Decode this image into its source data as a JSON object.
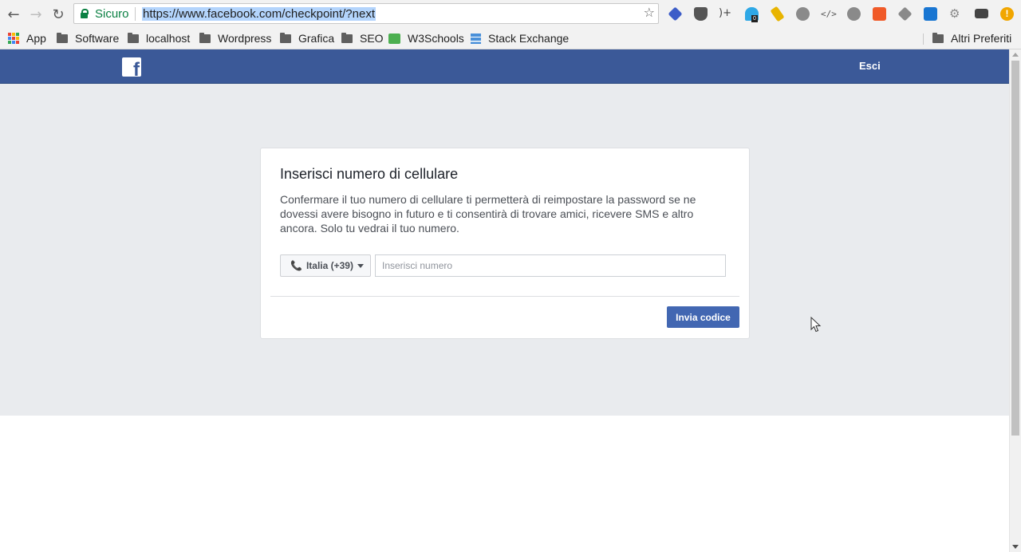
{
  "browser": {
    "back_icon": "arrow-left-icon",
    "forward_icon": "arrow-right-icon",
    "reload_icon": "reload-icon",
    "secure_label": "Sicuro",
    "url": "https://www.facebook.com/checkpoint/?next",
    "bookmark_star_icon": "star-icon",
    "extensions": [
      "box-extension-icon",
      "pocket-icon",
      "rss-plus-icon",
      "ghostery-icon",
      "broom-icon",
      "web-developer-icon",
      "code-icon",
      "wordpress-icon",
      "zoho-icon",
      "layers-icon",
      "cloud-icon",
      "gear-icon",
      "laptop-icon",
      "warning-icon"
    ],
    "extension_badge": "0"
  },
  "bookmarks": {
    "items": [
      {
        "label": "App",
        "icon": "apps-grid-icon"
      },
      {
        "label": "Software",
        "icon": "folder-icon"
      },
      {
        "label": "localhost",
        "icon": "folder-icon"
      },
      {
        "label": "Wordpress",
        "icon": "folder-icon"
      },
      {
        "label": "Grafica",
        "icon": "folder-icon"
      },
      {
        "label": "SEO",
        "icon": "folder-icon"
      },
      {
        "label": "W3Schools",
        "icon": "w3schools-icon"
      },
      {
        "label": "Stack Exchange",
        "icon": "stack-exchange-icon"
      }
    ],
    "other": "Altri Preferiti"
  },
  "header": {
    "logo_letter": "f",
    "logout_label": "Esci",
    "color": "#3b5998"
  },
  "dialog": {
    "title": "Inserisci numero di cellulare",
    "description": "Confermare il tuo numero di cellulare ti permetterà di reimpostare la password se ne dovessi avere bisogno in futuro e ti consentirà di trovare amici, ricevere SMS e altro ancora. Solo tu vedrai il tuo numero.",
    "country_label": "Italia (+39)",
    "phone_placeholder": "Inserisci numero",
    "submit_label": "Invia codice",
    "button_color": "#4267b2"
  }
}
